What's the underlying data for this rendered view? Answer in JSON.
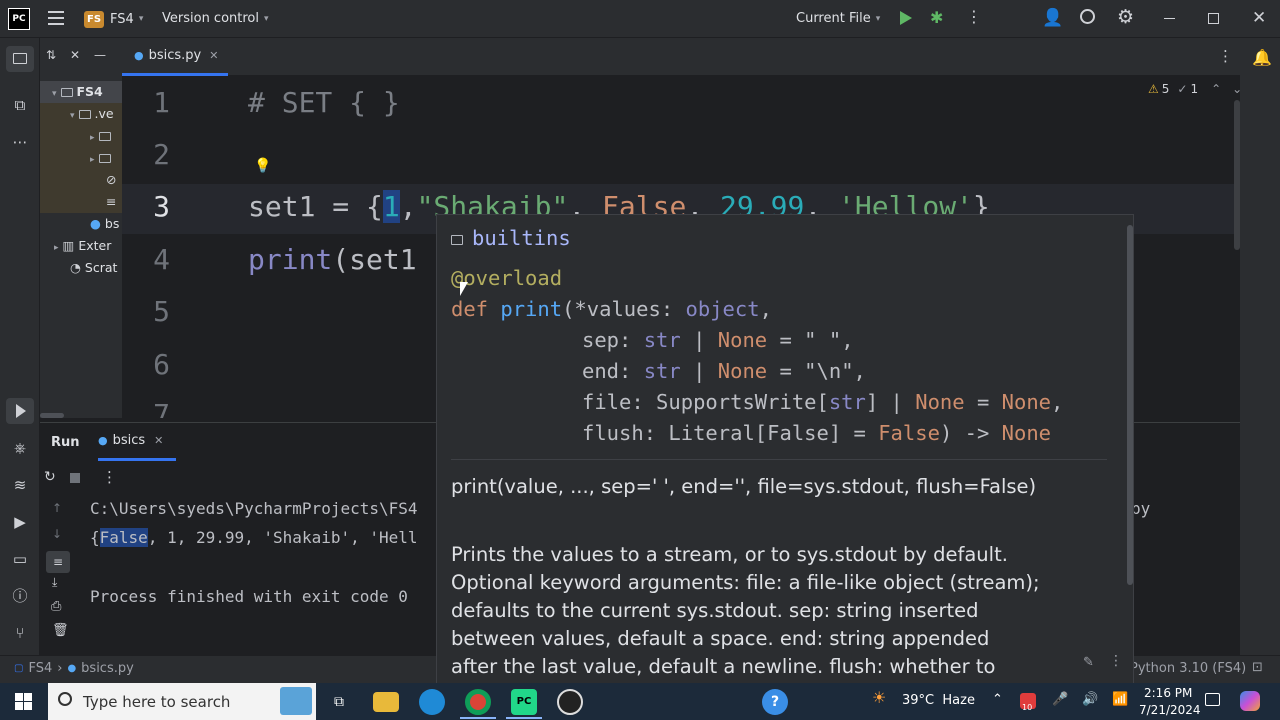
{
  "titlebar": {
    "app_icon": "PC",
    "project_badge": "FS",
    "project_name": "FS4",
    "vcs_label": "Version control",
    "run_config": "Current File"
  },
  "project_tree": {
    "root": "FS4",
    "venv": ".ve",
    "file": "bs",
    "external": "Exter",
    "scratches": "Scrat"
  },
  "editor": {
    "tab_label": "bsics.py",
    "warnings": "5",
    "checks": "1",
    "line_numbers": [
      "1",
      "2",
      "3",
      "4",
      "5",
      "6",
      "7"
    ],
    "line1": "# SET { }",
    "line3_var": "set1 = {",
    "line3_num": "1",
    "line3_comma": ",",
    "line3_str1": "\"Shakaib\"",
    "line3_bool": "False",
    "line3_float": "29.99",
    "line3_str2": "'Hellow'",
    "line3_close": "}",
    "line4_fn": "print",
    "line4_rest": "(set1"
  },
  "run_panel": {
    "title": "Run",
    "tab": "bsics",
    "cmd": "C:\\Users\\syeds\\PycharmProjects\\FS4",
    "cmd_tail": "py",
    "out_open": "{",
    "out_false": "False",
    "out_rest": ", 1, 29.99, 'Shakaib', 'Hell",
    "finished": "Process finished with exit code 0"
  },
  "popup": {
    "module": "builtins",
    "decorator": "@overload",
    "sig_def": "def",
    "sig_fn": "print",
    "sig_l1": "(*values: ",
    "sig_l1_type": "object",
    "sig_l2a": "sep: ",
    "sig_str": "str",
    "sig_pipe": " | ",
    "sig_none": "None",
    "sig_l2_def": " = \" \",",
    "sig_l3a": "end: ",
    "sig_l3_def": " = \"\\n\",",
    "sig_l4a": "file: SupportsWrite[",
    "sig_l4b": "] | ",
    "sig_l4_eq": " = ",
    "sig_l4_end": ",",
    "sig_l5a": "flush: Literal[False] = ",
    "sig_false": "False",
    "sig_l5b": ") -> ",
    "summary": "print(value, ..., sep=' ', end='', file=sys.stdout, flush=False)",
    "desc_lines": [
      "Prints the values to a stream, or to sys.stdout by default.",
      "Optional keyword arguments: file: a file-like object (stream);",
      "defaults to the current sys.stdout. sep: string inserted",
      "between values, default a space. end: string appended",
      "after the last value, default a newline. flush: whether to"
    ]
  },
  "statusbar": {
    "crumb1": "FS4",
    "crumb2": "bsics.py",
    "interpreter": "Python 3.10 (FS4)"
  },
  "taskbar": {
    "search_placeholder": "Type here to search",
    "weather": "39°C  Haze",
    "time": "2:16 PM",
    "date": "7/21/2024",
    "badge": "10"
  },
  "colors": {
    "accent": "#3574f0",
    "string": "#6aab73",
    "number": "#2aacb8",
    "keyword": "#cf8e6d",
    "function": "#56a8f5",
    "type": "#8888c6"
  }
}
